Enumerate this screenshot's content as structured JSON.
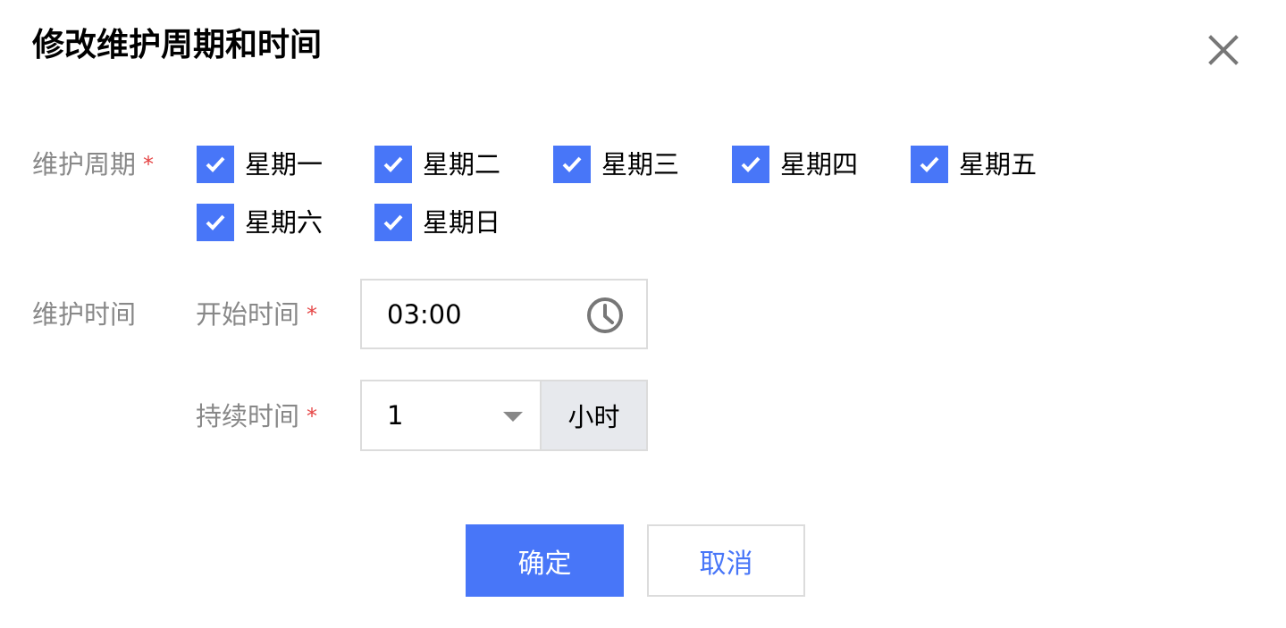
{
  "dialog": {
    "title": "修改维护周期和时间",
    "close_icon": "close-icon"
  },
  "cycle": {
    "label": "维护周期",
    "required_mark": "*",
    "days": [
      {
        "label": "星期一",
        "checked": true
      },
      {
        "label": "星期二",
        "checked": true
      },
      {
        "label": "星期三",
        "checked": true
      },
      {
        "label": "星期四",
        "checked": true
      },
      {
        "label": "星期五",
        "checked": true
      },
      {
        "label": "星期六",
        "checked": true
      },
      {
        "label": "星期日",
        "checked": true
      }
    ]
  },
  "time": {
    "label": "维护时间",
    "start": {
      "label": "开始时间",
      "required_mark": "*",
      "value": "03:00",
      "icon": "clock-icon"
    },
    "duration": {
      "label": "持续时间",
      "required_mark": "*",
      "value": "1",
      "unit": "小时",
      "icon": "caret-down-icon"
    }
  },
  "buttons": {
    "ok": "确定",
    "cancel": "取消"
  },
  "colors": {
    "accent": "#4876f8",
    "required": "#e54545",
    "label": "#888888",
    "border": "#dcdcdc",
    "unit_bg": "#e7e9ed"
  }
}
